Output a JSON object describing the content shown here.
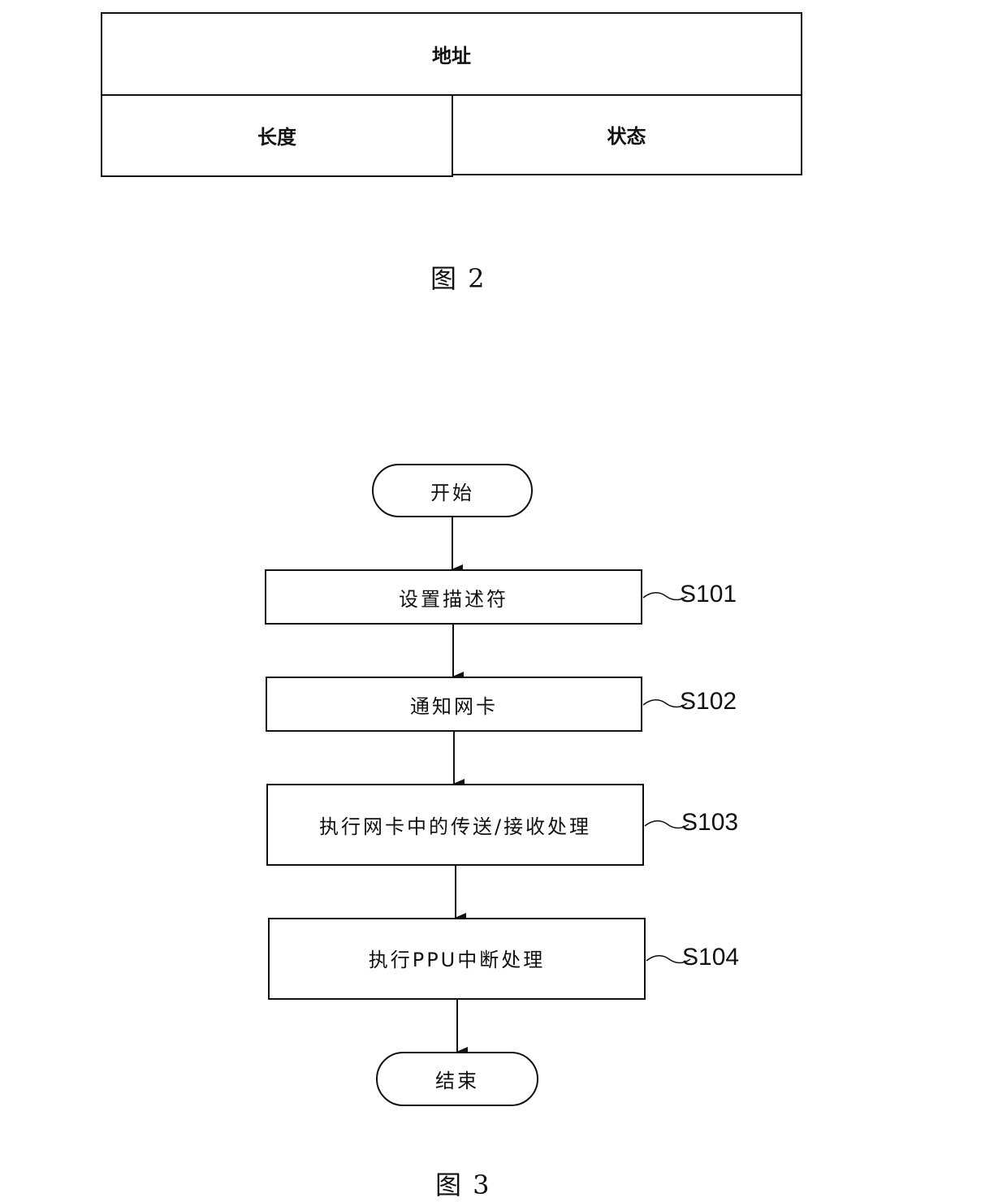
{
  "figure2": {
    "caption": "图  2",
    "descriptor_fields": {
      "address": "地址",
      "length": "长度",
      "status": "状态"
    }
  },
  "figure3": {
    "caption": "图  3",
    "start": "开始",
    "end": "结束",
    "steps": [
      {
        "id": "S101",
        "text": "设置描述符"
      },
      {
        "id": "S102",
        "text": "通知网卡"
      },
      {
        "id": "S103",
        "text": "执行网卡中的传送/接收处理"
      },
      {
        "id": "S104",
        "text": "执行PPU中断处理"
      }
    ]
  }
}
